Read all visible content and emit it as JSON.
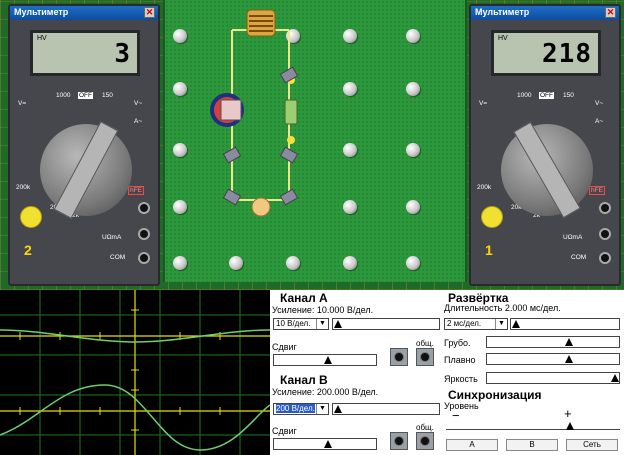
{
  "multimeter_left": {
    "title": "Мультиметр",
    "mode": "HV",
    "reading": "3",
    "number": "2"
  },
  "multimeter_right": {
    "title": "Мультиметр",
    "mode": "HV",
    "reading": "218",
    "number": "1"
  },
  "multimeter_labels": {
    "off": "OFF",
    "v_dc": "V=",
    "v_ac": "V~",
    "a_ac": "A~",
    "k1000": "1000",
    "k150": "150",
    "hfe": "hFE",
    "com": "COM",
    "ua": "UΩmA",
    "r200k": "200k",
    "r20k": "20k",
    "r2k": "2k"
  },
  "channel_a": {
    "title": "Канал А",
    "gain_label": "Усиление: 10.000 В/дел.",
    "gain_select": "10 В/дел.",
    "shift_label": "Сдвиг",
    "common_label": "общ.",
    "gain_level": 0.0,
    "shift_level": 0.5
  },
  "channel_b": {
    "title": "Канал В",
    "gain_label": "Усиление: 200.000 В/дел.",
    "gain_select": "200 В/дел.",
    "shift_label": "Сдвиг",
    "common_label": "общ.",
    "gain_level": 0.0,
    "shift_level": 0.5
  },
  "sweep": {
    "title": "Развёртка",
    "duration_label": "Длительность  2.000 мс/дел.",
    "duration_select": "2 мс/дел.",
    "coarse_label": "Грубо.",
    "fine_label": "Плавно",
    "brightness_label": "Яркость",
    "duration_level": 0.0,
    "coarse_level": 0.6,
    "fine_level": 0.6,
    "brightness_level": 0.98
  },
  "sync": {
    "title": "Синхронизация",
    "level_label": "Уровень",
    "minus": "−",
    "plus": "+",
    "btn_a": "А",
    "btn_b": "В",
    "btn_net": "Сеть"
  },
  "colors": {
    "trace": "#6fcf6f",
    "grid": "#1f7a1f",
    "axis": "#e8e000"
  }
}
